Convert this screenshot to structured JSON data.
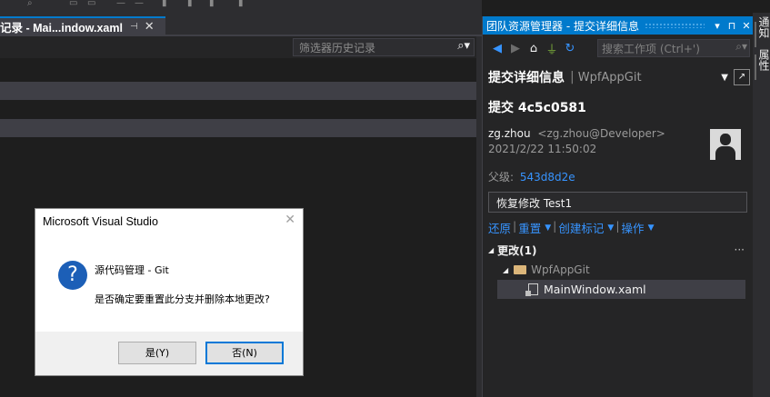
{
  "document": {
    "tab_title": "记录 - Mai...indow.xaml",
    "pin_icon": "pin-icon",
    "close_glyph": "✕",
    "filter_placeholder": "筛选器历史记录"
  },
  "team_explorer": {
    "title": "团队资源管理器 - 提交详细信息",
    "title_buttons": [
      "▾",
      "⊓",
      "✕"
    ],
    "search_placeholder": "搜索工作项 (Ctrl+')",
    "page_heading": "提交详细信息",
    "repo": "WpfAppGit",
    "commit_id": "提交 4c5c0581",
    "author_name": "zg.zhou",
    "author_email": "<zg.zhou@Developer>",
    "commit_date": "2021/2/22 11:50:02",
    "parent_label": "父级:",
    "parent_hash": "543d8d2e",
    "commit_message": "恢复修改 Test1",
    "actions": [
      "还原",
      "重置",
      "创建标记",
      "操作"
    ],
    "changes_label": "更改(1)",
    "more_glyph": "···",
    "folder_name": "WpfAppGit",
    "file_name": "MainWindow.xaml"
  },
  "side_tabs": [
    "通知",
    "属性"
  ],
  "dialog": {
    "title": "Microsoft Visual Studio",
    "heading": "源代码管理 - Git",
    "message": "是否确定要重置此分支并删除本地更改?",
    "yes_label": "是(Y)",
    "no_label": "否(N)",
    "icon": "question-icon"
  },
  "colors": {
    "accent": "#007acc",
    "link": "#3794ff",
    "background": "#1e1e1e",
    "panel": "#252526"
  }
}
